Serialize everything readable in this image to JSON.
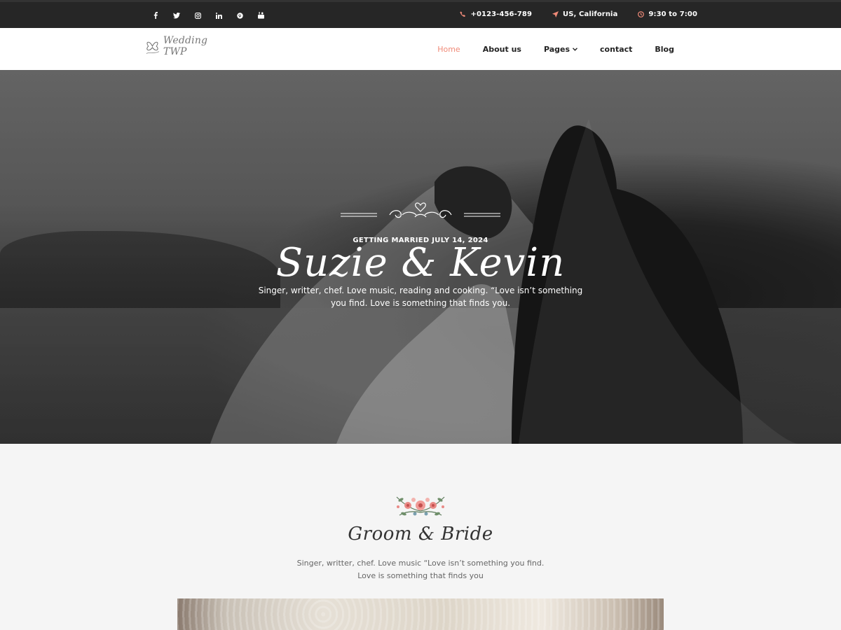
{
  "topbar": {
    "socials": [
      {
        "icon": "facebook-icon",
        "glyph": "f"
      },
      {
        "icon": "twitter-icon",
        "glyph": "t"
      },
      {
        "icon": "instagram-icon",
        "glyph": "ig"
      },
      {
        "icon": "linkedin-icon",
        "glyph": "in"
      },
      {
        "icon": "pinterest-icon",
        "glyph": "p"
      },
      {
        "icon": "youtube-icon",
        "glyph": "yt"
      }
    ],
    "phone": "+0123-456-789",
    "location": "US, California",
    "hours": "9:30 to 7:00",
    "accent": "#f08a78"
  },
  "header": {
    "logo_text": "Wedding TWP",
    "nav": [
      {
        "label": "Home",
        "active": true
      },
      {
        "label": "About us",
        "active": false
      },
      {
        "label": "Pages",
        "active": false,
        "has_dropdown": true
      },
      {
        "label": "contact",
        "active": false
      },
      {
        "label": "Blog",
        "active": false
      }
    ]
  },
  "hero": {
    "kicker": "GETTING MARRIED JULY 14, 2024",
    "names": "Suzie & Kevin",
    "description": "Singer, writter, chef. Love music, reading and cooking. “Love isn’t something you find. Love is something that finds you."
  },
  "section": {
    "title": "Groom & Bride",
    "description": "Singer, writter, chef. Love music “Love isn’t something you find. Love is something that finds you"
  }
}
